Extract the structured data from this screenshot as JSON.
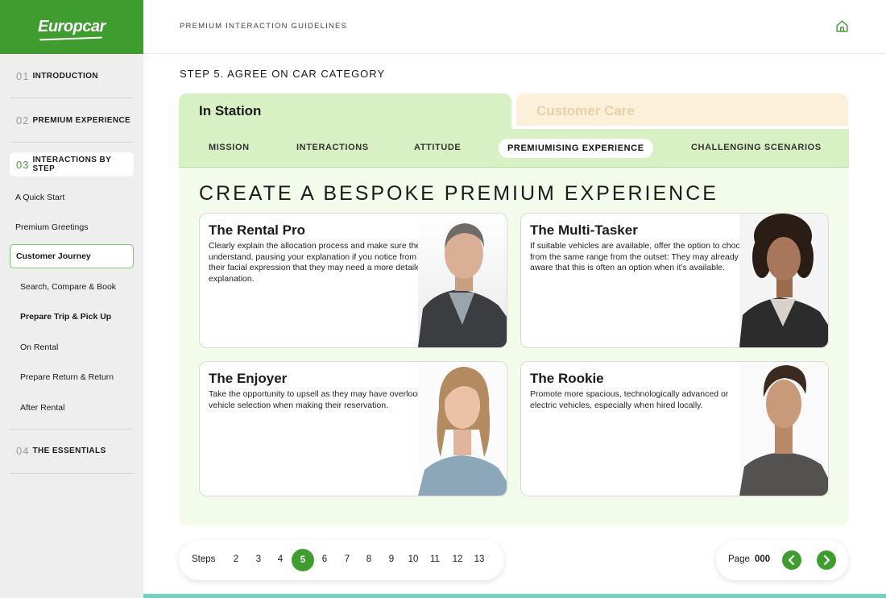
{
  "brand": {
    "logo": "Europcar",
    "accent": "#3f9d2f"
  },
  "sidebar": {
    "sections": [
      {
        "num": "01",
        "label": "INTRODUCTION"
      },
      {
        "num": "02",
        "label": "PREMIUM EXPERIENCE"
      },
      {
        "num": "03",
        "label": "INTERACTIONS BY STEP"
      },
      {
        "num": "04",
        "label": "THE ESSENTIALS"
      }
    ],
    "items": [
      "A Quick Start",
      "Premium Greetings",
      "Customer Journey"
    ],
    "subitems": [
      "Search, Compare & Book",
      "Prepare Trip & Pick Up",
      "On Rental",
      "Prepare Return & Return",
      "After Rental"
    ]
  },
  "header": {
    "title": "PREMIUM INTERACTION GUIDELINES",
    "home_icon": "home-icon"
  },
  "step_title": "STEP 5. AGREE ON CAR CATEGORY",
  "tabs": [
    "In Station",
    "Customer Care"
  ],
  "subtabs": [
    "MISSION",
    "INTERACTIONS",
    "ATTITUDE",
    "PREMIUMISING EXPERIENCE",
    "CHALLENGING SCENARIOS"
  ],
  "content": {
    "title": "CREATE A BESPOKE PREMIUM EXPERIENCE",
    "cards": [
      {
        "title": "The Rental Pro",
        "text": "Clearly explain the allocation process and make sure they understand, pausing your explanation if you notice from their facial expression that they may need a more detailed explanation."
      },
      {
        "title": "The Multi-Tasker",
        "text": "If suitable vehicles are available, offer the option to choose from the same range from the outset: They may already be aware that this is often an option when it’s available."
      },
      {
        "title": "The Enjoyer",
        "text": "Take the opportunity to upsell as they may have overlooked vehicle selection when making their reservation."
      },
      {
        "title": "The Rookie",
        "text": "Promote more spacious, technologically advanced or electric vehicles, especially when hired locally."
      }
    ]
  },
  "footer": {
    "steps_label": "Steps",
    "steps": [
      "2",
      "3",
      "4",
      "5",
      "6",
      "7",
      "8",
      "9",
      "10",
      "11",
      "12",
      "13"
    ],
    "active_step": "5",
    "page_label": "Page",
    "page_value": "000",
    "prev_icon": "chevron-left-icon",
    "next_icon": "chevron-right-icon"
  }
}
